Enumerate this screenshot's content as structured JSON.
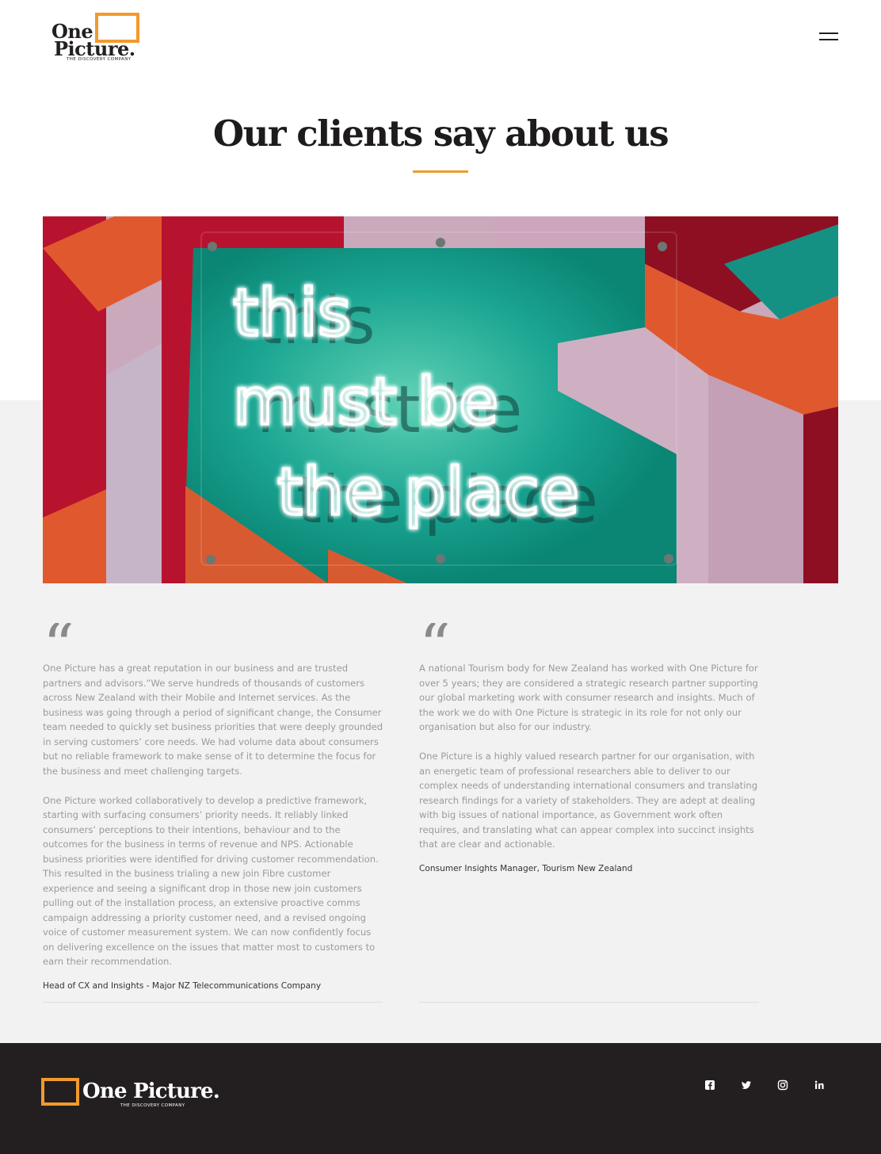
{
  "brand": {
    "name_line1": "One",
    "name_line2": "Picture.",
    "name_full": "One Picture.",
    "tagline": "THE DISCOVERY COMPANY",
    "accent_color": "#f29a2e",
    "dark_color": "#231f20"
  },
  "header": {
    "menu_icon": "hamburger-icon"
  },
  "main": {
    "title": "Our clients say about us",
    "hero_image": {
      "icon": "neon-sign-photo",
      "sign_lines": [
        "this",
        "must be",
        "the place"
      ]
    },
    "testimonials": [
      {
        "quote_glyph": "“",
        "paragraphs": [
          "One Picture has a great reputation in our business and are trusted partners and advisors.”We serve hundreds of thousands of customers across New Zealand with their Mobile and Internet services. As the business was going through a period of significant change, the Consumer team needed to quickly set business priorities that were deeply grounded in serving customers’ core needs. We had volume data about consumers but no reliable framework to make sense of it to determine the focus for the business and meet challenging targets.",
          "One Picture worked collaboratively to develop a predictive framework, starting with surfacing consumers’ priority needs. It reliably linked consumers’ perceptions to their intentions, behaviour and to the outcomes for the business in terms of revenue and NPS. Actionable business priorities were identified for driving customer recommendation. This resulted in the business trialing a new join Fibre customer experience and seeing a significant drop in those new join customers pulling out of the installation process, an extensive proactive comms campaign addressing a priority customer need, and a revised ongoing voice of customer measurement system. We can now confidently focus on delivering excellence on the issues that matter most to customers to earn their recommendation."
        ],
        "attribution": "Head of CX and Insights - Major NZ Telecommunications Company"
      },
      {
        "quote_glyph": "“",
        "paragraphs": [
          "A national Tourism body for New Zealand has worked with One Picture for over 5 years; they are considered a strategic research partner supporting our global marketing work with consumer research and insights. Much of the work we do with One Picture is strategic in its role for not only our organisation but also for our industry.",
          "One Picture is a highly valued research partner for our organisation, with an energetic team of professional researchers able to deliver to our complex needs of understanding international consumers and translating research findings for a variety of stakeholders. They are adept at dealing with big issues of national importance, as Government work often requires, and translating what can appear complex into succinct insights that are clear and actionable."
        ],
        "attribution": "Consumer Insights Manager, Tourism New Zealand"
      }
    ]
  },
  "footer": {
    "social": [
      {
        "icon": "facebook-icon"
      },
      {
        "icon": "twitter-icon"
      },
      {
        "icon": "instagram-icon"
      },
      {
        "icon": "linkedin-icon"
      }
    ]
  }
}
